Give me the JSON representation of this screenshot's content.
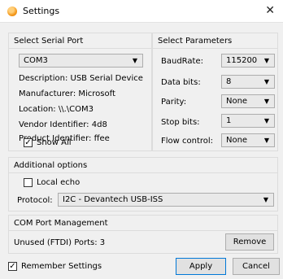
{
  "window": {
    "title": "Settings",
    "close_glyph": "✕"
  },
  "serial_port": {
    "title": "Select Serial Port",
    "selected_port": "COM3",
    "info": [
      "Description: USB Serial Device",
      "Manufacturer: Microsoft",
      "Location: \\\\.\\COM3",
      "Vendor Identifier: 4d8",
      "Product Identifier: ffee"
    ],
    "show_all_label": "Show All",
    "show_all_checked": true
  },
  "parameters": {
    "title": "Select Parameters",
    "rows": [
      {
        "label": "BaudRate:",
        "value": "115200"
      },
      {
        "label": "Data bits:",
        "value": "8"
      },
      {
        "label": "Parity:",
        "value": "None"
      },
      {
        "label": "Stop bits:",
        "value": "1"
      },
      {
        "label": "Flow control:",
        "value": "None"
      }
    ]
  },
  "additional": {
    "title": "Additional options",
    "local_echo_label": "Local echo",
    "local_echo_checked": false,
    "protocol_label": "Protocol:",
    "protocol_value": "I2C - Devantech USB-ISS"
  },
  "com_management": {
    "title": "COM Port Management",
    "unused_ports": "Unused (FTDI) Ports: 3",
    "remove_label": "Remove"
  },
  "footer": {
    "remember_label": "Remember Settings",
    "remember_checked": true,
    "apply_label": "Apply",
    "cancel_label": "Cancel"
  },
  "icons": {
    "combo_arrow": "▼",
    "check": "✓"
  },
  "colors": {
    "accent": "#0078d7",
    "app_icon": "#f59a1d"
  }
}
